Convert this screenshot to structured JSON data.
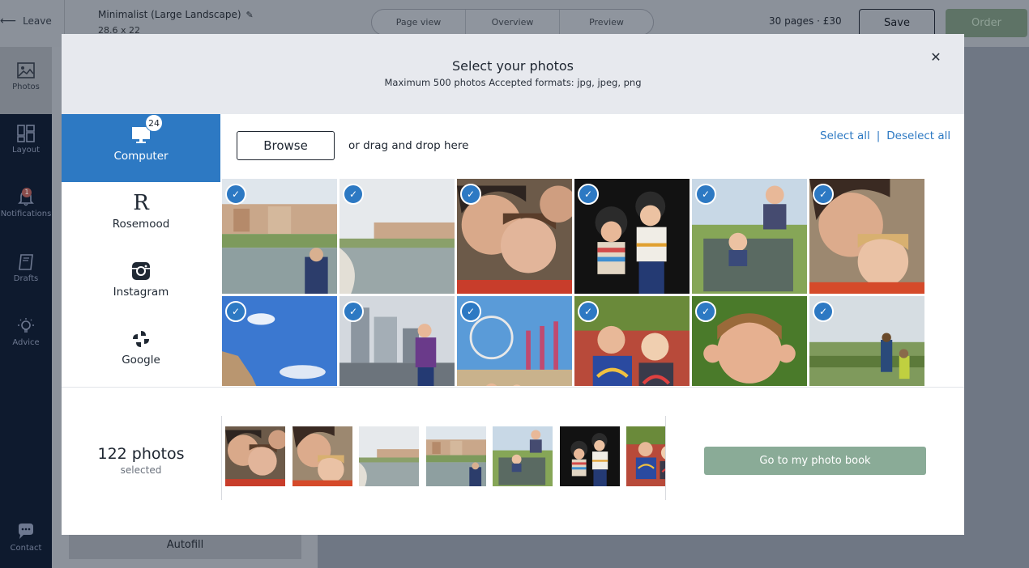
{
  "topbar": {
    "leave_label": "Leave",
    "project_title": "Minimalist (Large Landscape)",
    "project_size": "28.6 x 22",
    "view_tabs": [
      "Page view",
      "Overview",
      "Preview"
    ],
    "pages_price": "30 pages · £30",
    "save_label": "Save",
    "order_label": "Order"
  },
  "sidenav": {
    "items": [
      {
        "label": "Photos",
        "icon": "image-icon"
      },
      {
        "label": "Layout",
        "icon": "layout-icon"
      },
      {
        "label": "Notifications",
        "icon": "bell-icon",
        "badge": "1"
      },
      {
        "label": "Drafts",
        "icon": "book-icon"
      },
      {
        "label": "Advice",
        "icon": "lightbulb-icon"
      },
      {
        "label": "Contact",
        "icon": "chat-icon"
      }
    ]
  },
  "left_panel": {
    "autofill_label": "Autofill"
  },
  "modal": {
    "title": "Select your photos",
    "subtitle": "Maximum 500 photos Accepted formats: jpg, jpeg, png",
    "sources": [
      {
        "label": "Computer",
        "icon": "monitor-icon",
        "badge": "24",
        "active": true
      },
      {
        "label": "Rosemood",
        "icon": "rosemood-logo-icon"
      },
      {
        "label": "Instagram",
        "icon": "instagram-icon"
      },
      {
        "label": "Google",
        "icon": "google-photos-icon"
      }
    ],
    "browse_label": "Browse",
    "drag_text": "or drag and drop here",
    "select_all": "Select all",
    "deselect_all": "Deselect all",
    "photo_grid": [
      {
        "scene": "canal-town",
        "checked": true
      },
      {
        "scene": "canal-town-2",
        "checked": true
      },
      {
        "scene": "selfie-family",
        "checked": true
      },
      {
        "scene": "kids-helmets",
        "checked": true
      },
      {
        "scene": "kids-tractor",
        "checked": true
      },
      {
        "scene": "selfie-mother-child",
        "checked": true
      },
      {
        "scene": "blue-sky-cliff",
        "checked": true
      },
      {
        "scene": "city-boy",
        "checked": true
      },
      {
        "scene": "pier-beach",
        "checked": true
      },
      {
        "scene": "kids-rainbow-shirts",
        "checked": true
      },
      {
        "scene": "boy-ears",
        "checked": true
      },
      {
        "scene": "field-kids",
        "checked": true
      }
    ],
    "selected_count": "122 photos",
    "selected_label": "selected",
    "selected_strip": [
      "selfie-family",
      "selfie-mother-child",
      "canal-town-2",
      "canal-town",
      "kids-tractor",
      "kids-helmets",
      "kids-rainbow-shirts"
    ],
    "go_button": "Go to my photo book",
    "accent_color": "#2d79c3",
    "go_button_color": "#8aab97"
  }
}
